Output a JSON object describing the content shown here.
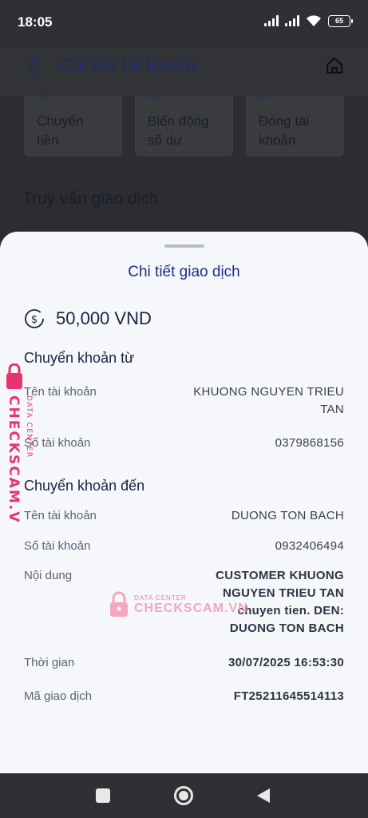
{
  "status_bar": {
    "time": "18:05",
    "battery": "65"
  },
  "header": {
    "title": "Chi tiết tài khoản"
  },
  "quick_actions": [
    {
      "line1": "Chuyển",
      "line2": "tiền"
    },
    {
      "line1": "Biến động",
      "line2": "số dư"
    },
    {
      "line1": "Đóng tài",
      "line2": "khoản"
    }
  ],
  "section_query": "Truy vấn giao dịch",
  "sheet": {
    "title": "Chi tiết giao dịch",
    "amount": "50,000 VND",
    "from_title": "Chuyển khoản từ",
    "from": {
      "name_label": "Tên tài khoản",
      "name_line1": "KHUONG NGUYEN TRIEU",
      "name_line2": "TAN",
      "number_label": "Số tài khoản",
      "number": "0379868156"
    },
    "to_title": "Chuyển khoản đến",
    "to": {
      "name_label": "Tên tài khoản",
      "name": "DUONG TON BACH",
      "number_label": "Số tài khoản",
      "number": "0932406494"
    },
    "content_label": "Nội dung",
    "content_lines": [
      "CUSTOMER KHUONG",
      "NGUYEN TRIEU TAN",
      "chuyen tien. DEN:",
      "DUONG TON BACH"
    ],
    "time_label": "Thời gian",
    "time": "30/07/2025 16:53:30",
    "txn_label": "Mã giao dịch",
    "txn_id": "FT25211645514113"
  },
  "watermark": {
    "brand": "CHECKSCAM.VN",
    "tag": "DATA CENTER",
    "color": "#e8336f"
  }
}
